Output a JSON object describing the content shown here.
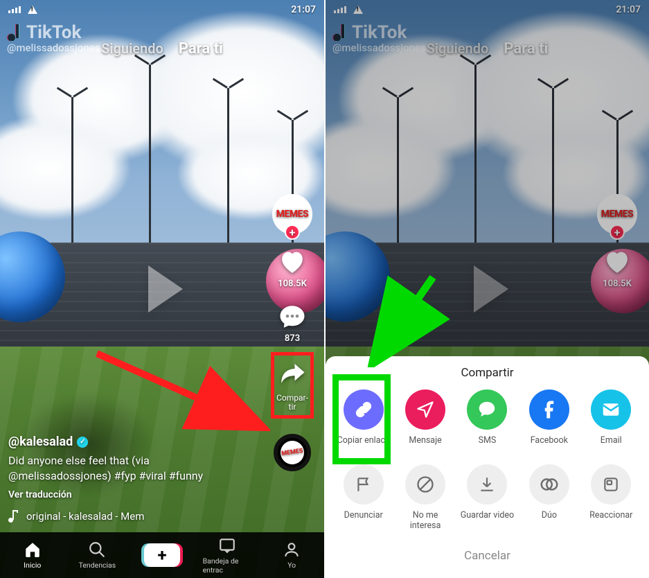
{
  "statusbar": {
    "time": "21:07"
  },
  "watermark": {
    "brand": "TikTok",
    "handle": "@melissadossjones"
  },
  "tabs": {
    "following": "Siguiendo",
    "forYou": "Para ti"
  },
  "rail": {
    "avatarText": "MEMES",
    "likes": "108.5K",
    "comments": "873",
    "shareLabel": "Compar-\ntir",
    "discText": "MEMES"
  },
  "info": {
    "author": "@kalesalad",
    "caption": "Did anyone else feel that (via @melissadossjones) #fyp #viral #funny",
    "translate": "Ver traducción",
    "music": "original - kalesalad - Mem"
  },
  "nav": {
    "home": "Inicio",
    "discover": "Tendencias",
    "inbox": "Bandeja de entrac",
    "me": "Yo"
  },
  "sheet": {
    "title": "Compartir",
    "copylink": "Copiar enlace",
    "message": "Mensaje",
    "sms": "SMS",
    "facebook": "Facebook",
    "email": "Email",
    "report": "Denunciar",
    "notinterested": "No me interesa",
    "save": "Guardar video",
    "duet": "Dúo",
    "react": "Reaccionar",
    "cancel": "Cancelar"
  }
}
